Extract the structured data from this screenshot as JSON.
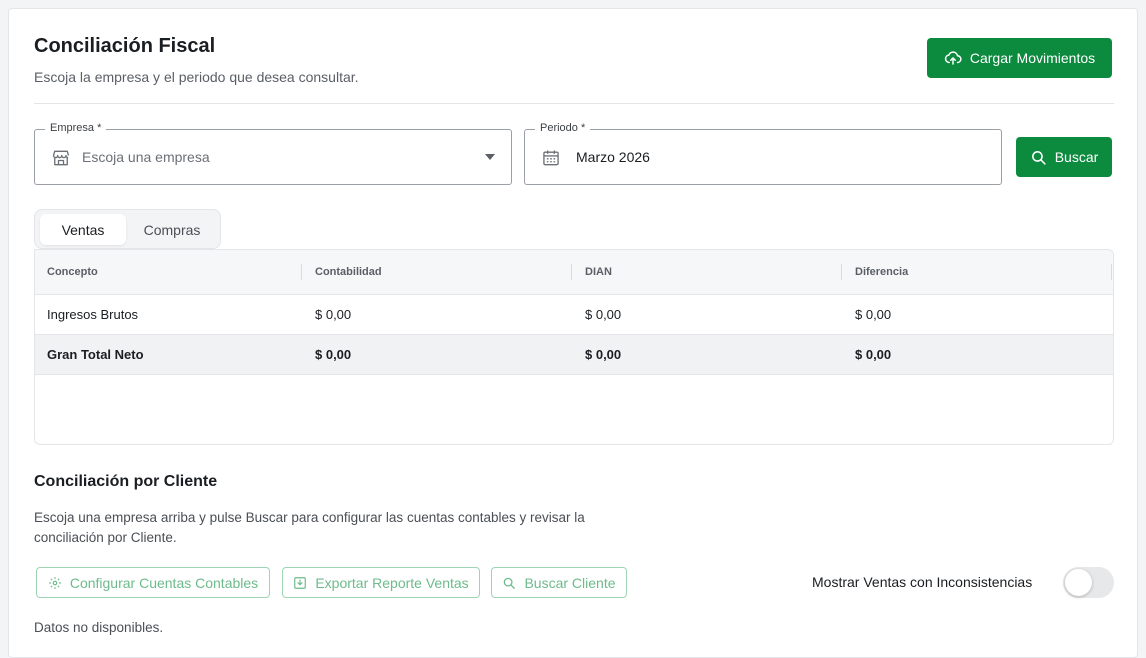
{
  "header": {
    "title": "Conciliación Fiscal",
    "subtitle": "Escoja la empresa y el periodo que desea consultar.",
    "upload_button": "Cargar Movimientos"
  },
  "filters": {
    "empresa": {
      "label": "Empresa",
      "required_mark": "*",
      "placeholder": "Escoja una empresa"
    },
    "periodo": {
      "label": "Periodo",
      "required_mark": "*",
      "value": "Marzo 2026"
    },
    "search_button": "Buscar"
  },
  "tabs": [
    {
      "label": "Ventas",
      "active": true
    },
    {
      "label": "Compras",
      "active": false
    }
  ],
  "table": {
    "columns": [
      "Concepto",
      "Contabilidad",
      "DIAN",
      "Diferencia"
    ],
    "rows": [
      [
        "Ingresos Brutos",
        "$ 0,00",
        "$ 0,00",
        "$ 0,00"
      ],
      [
        "Gran Total Neto",
        "$ 0,00",
        "$ 0,00",
        "$ 0,00"
      ]
    ]
  },
  "client_section": {
    "title": "Conciliación por Cliente",
    "description": "Escoja una empresa arriba y pulse Buscar para configurar las cuentas contables y revisar la conciliación por Cliente.",
    "buttons": {
      "configure": "Configurar Cuentas Contables",
      "export": "Exportar Reporte Ventas",
      "search_client": "Buscar Cliente"
    },
    "toggle_label": "Mostrar Ventas con Inconsistencias",
    "toggle_on": false,
    "no_data": "Datos no disponibles."
  },
  "colors": {
    "primary": "#0c8a3e",
    "outline_border": "#9fd4b3",
    "outline_text": "#6dbb8b"
  }
}
